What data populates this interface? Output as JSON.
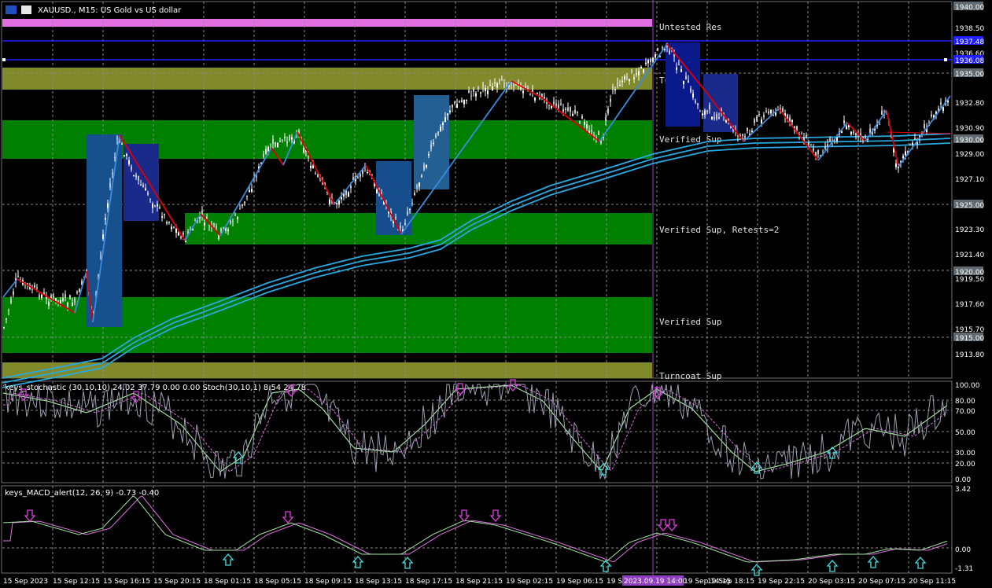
{
  "window": {
    "symbol_title": "XAUUSD., M15:  US Gold vs US dollar"
  },
  "main_chart": {
    "price_labels": [
      "1940.00",
      "1938.50",
      "1936.60",
      "1935.00",
      "1932.80",
      "1930.90",
      "1930.00",
      "1929.00",
      "1927.10",
      "1925.00",
      "1923.30",
      "1921.40",
      "1920.00",
      "1919.50",
      "1917.60",
      "1915.70",
      "1915.00",
      "1913.80"
    ],
    "highlight_price_labels": [
      "1937.48",
      "1936.08"
    ],
    "zones": [
      {
        "label": "Untested Res",
        "color": "#e070e0"
      },
      {
        "label": "Turncoat Sup",
        "color": "#808a2a"
      },
      {
        "label": "Verified Sup",
        "color": "#008000"
      },
      {
        "label": "Verified Sup, Retests=2",
        "color": "#008000"
      },
      {
        "label": "Verified Sup",
        "color": "#008000"
      },
      {
        "label": "Turncoat Sup",
        "color": "#808a2a"
      }
    ]
  },
  "stoch_panel": {
    "title": "keys_stochastic (30,10,10) 24.02 37.79 0.00 0.00 Stoch(30,10,1) 8.54 24.78",
    "levels": [
      "100.00",
      "80.00",
      "70.00",
      "50.00",
      "30.00",
      "20.00",
      "0.00"
    ]
  },
  "macd_panel": {
    "title": "keys_MACD_alert(12, 26, 9) -0.73 -0.40",
    "levels": [
      "3.42",
      "0.00",
      "-1.31"
    ]
  },
  "time_axis": {
    "labels": [
      "15 Sep 2023",
      "15 Sep 12:15",
      "15 Sep 16:15",
      "15 Sep 20:15",
      "18 Sep 01:15",
      "18 Sep 05:15",
      "18 Sep 09:15",
      "18 Sep 13:15",
      "18 Sep 17:15",
      "18 Sep 21:15",
      "19 Sep 02:15",
      "19 Sep 06:15",
      "19 Sep",
      "19 Sep 14:15",
      "19 Sep 18:15",
      "19 Sep 22:15",
      "20 Sep 03:15",
      "20 Sep 07:15",
      "20 Sep 11:15"
    ],
    "cursor_label": "2023.09.19 14:00"
  },
  "colors": {
    "background": "#000000",
    "grid": "#8a8a8a",
    "candle_bull": "#ffffff",
    "ma_lines": "#2aa8e0",
    "zigzag_down": "#e00000",
    "zigzag_up": "#3a8ae0",
    "arrow_down": "#e040e0",
    "arrow_up": "#40e0e0",
    "signal_line": "#e070e0",
    "main_line": "#a0e0a0"
  }
}
